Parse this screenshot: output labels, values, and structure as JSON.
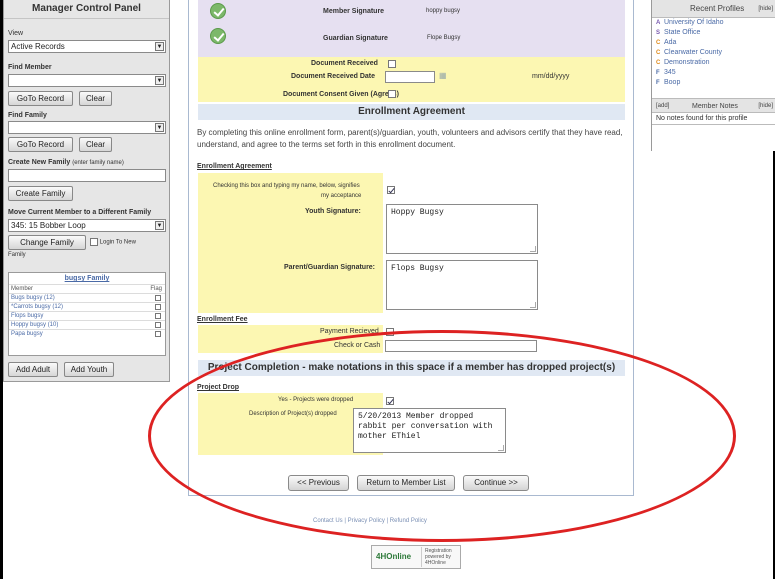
{
  "left_panel": {
    "title": "Manager Control Panel",
    "view_label": "View",
    "view_value": "Active Records",
    "find_member_label": "Find Member",
    "goto_label": "GoTo Record",
    "clear_label": "Clear",
    "find_family_label": "Find Family",
    "create_family_label": "Create New Family",
    "create_family_hint": "(enter family name)",
    "create_family_button": "Create Family",
    "move_label": "Move Current Member to a Different Family",
    "move_value": "345: 15 Bobber Loop",
    "change_family_button": "Change Family",
    "login_new_family": "Login To New",
    "login_new_family_2": "Family",
    "family": {
      "title": "bugsy Family",
      "col_member": "Member",
      "col_flag": "Flag",
      "rows": [
        "Bugs bugsy (12)",
        "*Carrots bugsy (12)",
        "Flops bugsy",
        "Hoppy bugsy (10)",
        "Papa bugsy"
      ]
    },
    "add_adult": "Add Adult",
    "add_youth": "Add Youth"
  },
  "main": {
    "member_sig_label": "Member Signature",
    "member_sig_value": "hoppy bugsy",
    "guardian_sig_label": "Guardian Signature",
    "guardian_sig_value": "Flope Bugsy",
    "doc_received": "Document Received",
    "doc_received_date": "Document Received Date",
    "date_format": "mm/dd/yyyy",
    "consent": "Document Consent Given (Agrees)",
    "enrollment_title": "Enrollment Agreement",
    "agreement_text": "By completing this online enrollment form, parent(s)/guardian, youth, volunteers and advisors certify that they have read, understand, and agree to the terms set forth in this enrollment document.",
    "enrollment_agreement_label": "Enrollment Agreement",
    "check_text_1": "Checking this box and typing my name, below, signifies",
    "check_text_2": "my acceptance",
    "youth_sig_label": "Youth Signature:",
    "youth_sig_value": "Hoppy Bugsy",
    "parent_sig_label": "Parent/Guardian Signature:",
    "parent_sig_value": "Flops Bugsy",
    "enrollment_fee": "Enrollment Fee",
    "payment_received": "Payment Recieved",
    "check_or_cash": "Check or Cash",
    "project_title": "Project Completion - make notations in this space if a member has dropped project(s)",
    "project_drop": "Project Drop",
    "yes_dropped": "Yes - Projects were dropped",
    "description_label": "Description of Project(s) dropped",
    "description_value": "5/20/2013 Member dropped\nrabbit per conversation with\nmother EThiel",
    "prev_button": "<< Previous",
    "return_button": "Return to Member List",
    "continue_button": "Continue >>",
    "footer": "Contact Us   |   Privacy Policy   |   Refund Policy",
    "badge_logo": "4HOnline",
    "badge_text_1": "Registration",
    "badge_text_2": "powered by",
    "badge_text_3": "4HOnline"
  },
  "right_panel": {
    "recent_title": "Recent Profiles",
    "hide": "[hide]",
    "recent": [
      {
        "letter": "A",
        "name": "University Of Idaho",
        "color": "#7a5bb0"
      },
      {
        "letter": "S",
        "name": "State Office",
        "color": "#7a5bb0"
      },
      {
        "letter": "C",
        "name": "Ada",
        "color": "#e08a1a"
      },
      {
        "letter": "C",
        "name": "Clearwater County",
        "color": "#e08a1a"
      },
      {
        "letter": "C",
        "name": "Demonstration",
        "color": "#e08a1a"
      },
      {
        "letter": "F",
        "name": "345",
        "color": "#4a6aa6"
      },
      {
        "letter": "F",
        "name": "Boop",
        "color": "#4a6aa6"
      }
    ],
    "notes_add": "[add]",
    "notes_title": "Member Notes",
    "notes_hide": "[hide]",
    "notes_empty": "No notes found for this profile"
  }
}
